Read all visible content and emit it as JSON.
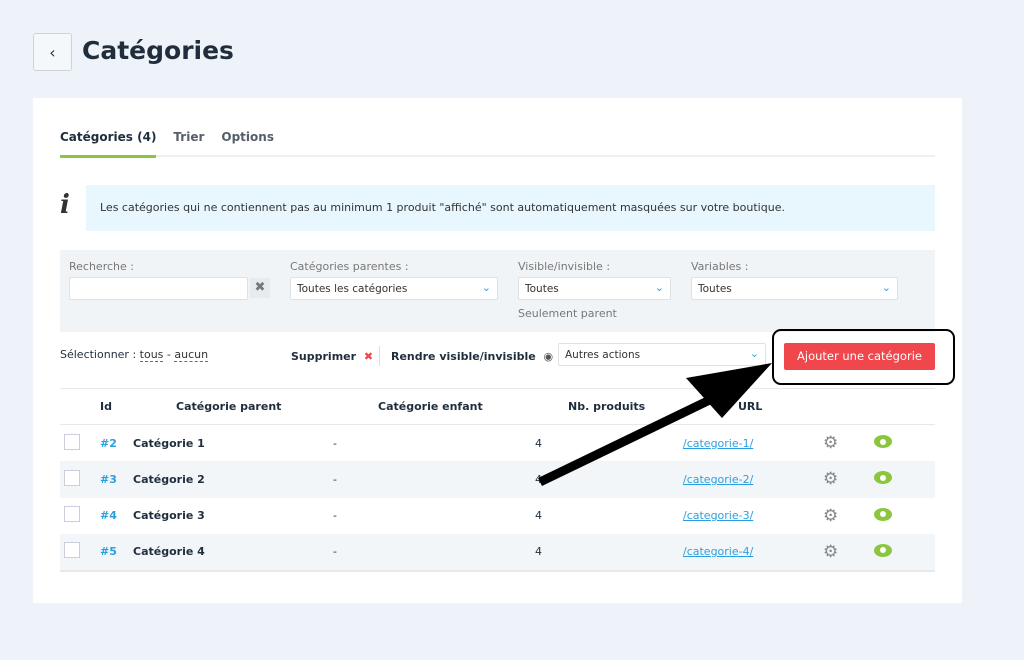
{
  "header": {
    "title": "Catégories",
    "back_icon": "‹"
  },
  "tabs": [
    {
      "label": "Catégories (4)",
      "active": true
    },
    {
      "label": "Trier"
    },
    {
      "label": "Options"
    }
  ],
  "info": {
    "icon": "i",
    "text": "Les catégories qui ne contiennent pas au minimum 1 produit \"affiché\" sont automatiquement masquées sur votre boutique."
  },
  "filters": {
    "search_label": "Recherche :",
    "search_value": "",
    "clear_icon": "✖",
    "parent_label": "Catégories parentes :",
    "parent_value": "Toutes les catégories",
    "visible_label": "Visible/invisible :",
    "visible_value": "Toutes",
    "only_parent": "Seulement parent",
    "variables_label": "Variables :",
    "variables_value": "Toutes"
  },
  "actions": {
    "select_label": "Sélectionner :",
    "all": "tous",
    "sep": "-",
    "none": "aucun",
    "delete": "Supprimer",
    "delete_icon": "✖",
    "toggle": "Rendre visible/invisible",
    "other": "Autres actions",
    "add": "Ajouter une catégorie"
  },
  "table": {
    "headers": [
      "Id",
      "Catégorie parent",
      "Catégorie enfant",
      "Nb. produits",
      "URL"
    ],
    "rows": [
      {
        "id": "#2",
        "parent": "Catégorie 1",
        "child": "-",
        "count": "4",
        "url": "/categorie-1/"
      },
      {
        "id": "#3",
        "parent": "Catégorie 2",
        "child": "-",
        "count": "4",
        "url": "/categorie-2/"
      },
      {
        "id": "#4",
        "parent": "Catégorie 3",
        "child": "-",
        "count": "4",
        "url": "/categorie-3/"
      },
      {
        "id": "#5",
        "parent": "Catégorie 4",
        "child": "-",
        "count": "4",
        "url": "/categorie-4/"
      }
    ]
  },
  "colors": {
    "accent": "#8cc63f",
    "link": "#2a9fe0",
    "danger": "#f0474d"
  }
}
